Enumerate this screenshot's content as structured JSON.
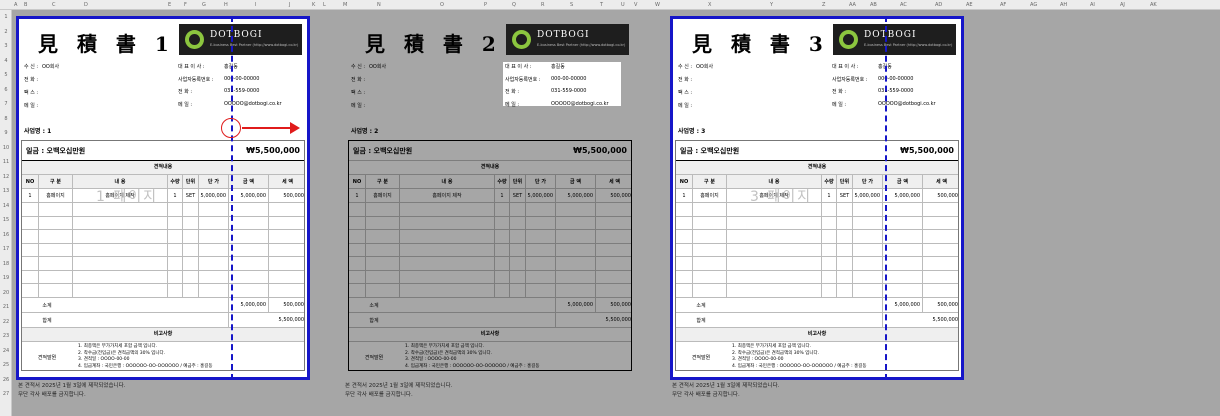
{
  "column_headers": [
    "A",
    "B",
    "C",
    "D",
    "E",
    "F",
    "G",
    "H",
    "I",
    "J",
    "K",
    "L",
    "M",
    "N",
    "O",
    "P",
    "Q",
    "R",
    "S",
    "T",
    "U",
    "V",
    "W",
    "X",
    "Y",
    "Z",
    "AA",
    "AB",
    "AC",
    "AD",
    "AE",
    "AF",
    "AG",
    "AH",
    "AI",
    "AJ",
    "AK"
  ],
  "row_numbers": [
    "1",
    "2",
    "3",
    "4",
    "5",
    "6",
    "7",
    "8",
    "9",
    "10",
    "11",
    "12",
    "13",
    "14",
    "15",
    "16",
    "17",
    "18",
    "19",
    "20",
    "21",
    "22",
    "23",
    "24",
    "25",
    "26",
    "27"
  ],
  "logo": {
    "brand": "DOTBOGI",
    "tagline": "E-business Best Partner  (http://www.dotbogi.co.kr)"
  },
  "recipient_labels": [
    "수 신 :",
    "전 화 :",
    "팩 스 :",
    "메 일 :"
  ],
  "recipient_value": "OO회사",
  "company_labels": [
    "대  표  이  사 :",
    "사업자등록번호 :",
    "전        화 :",
    "메          일 :"
  ],
  "company_values": [
    "홍길동",
    "000-00-00000",
    "031-559-0000",
    "OOOOO@dotbogi.co.kr"
  ],
  "sheets": [
    {
      "title": "見 積 書 1",
      "project": "사업명 : 1",
      "watermark": "1 페이지"
    },
    {
      "title": "見 積 書 2",
      "project": "사업명 : 2",
      "watermark": ""
    },
    {
      "title": "見 積 書 3",
      "project": "사업명 : 3",
      "watermark": "3 페이지"
    }
  ],
  "amount_label": "일금 : 오백오십만원",
  "amount_value": "₩5,500,000",
  "section_estimate": "견적내용",
  "table_headers": [
    "NO",
    "구  분",
    "내        용",
    "수량",
    "단위",
    "단 가",
    "금 액",
    "세 액"
  ],
  "item_row": {
    "no": "1",
    "category": "홈페이지",
    "content": "홈페이지 제작",
    "qty": "1",
    "unit": "SET",
    "unit_price": "5,000,000",
    "amount": "5,000,000",
    "tax": "500,000"
  },
  "subtotal_label": "소계",
  "subtotal_amount": "5,000,000",
  "subtotal_tax": "500,000",
  "total_label": "합계",
  "total_value": "5,500,000",
  "section_remarks": "비고사항",
  "remarks_label": "견적말뭔",
  "remarks": [
    "1. 최종액은 부가가치세 포함 금액 입니다.",
    "2. 착수금(전입금)은 견적금액의 30% 입니다.",
    "3. 견적일 : OOOO-00-00",
    "4. 입금계좌 : 국민은행 : OOOOOO-OO-OOOOOO  / 예금주 : 홍길동"
  ],
  "footer": [
    "본 견적서 2025년 1월 3일에 제작되었습니다.",
    "무단 각사 배포를 금지합니다."
  ],
  "colors": {
    "print_border": "#1616c8",
    "annotation": "#e01b1b",
    "logo_green": "#8cc63f"
  }
}
